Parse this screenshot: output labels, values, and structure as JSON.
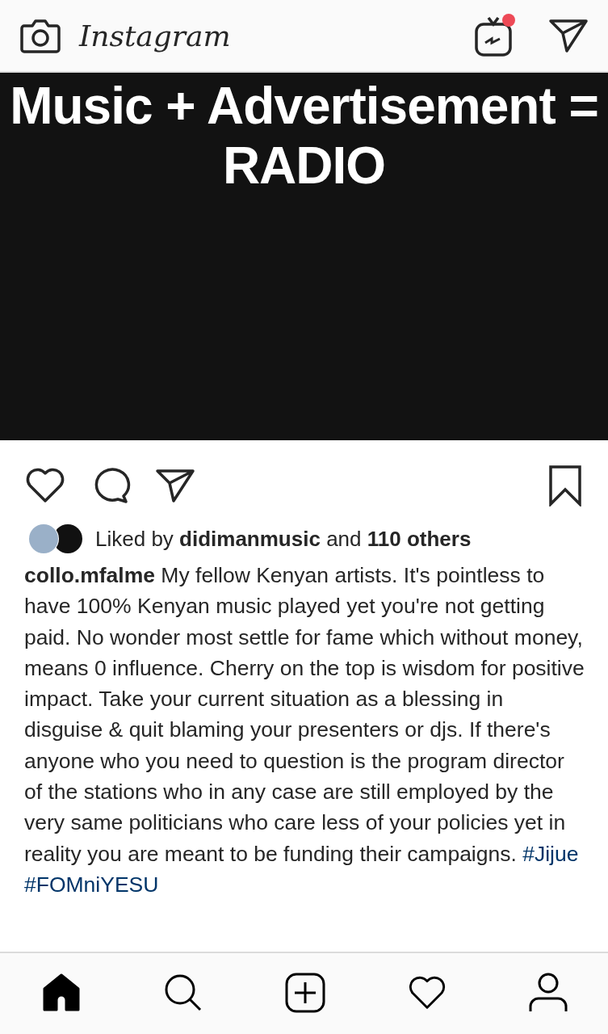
{
  "header": {
    "logo": "Instagram",
    "tv_notification": true
  },
  "post": {
    "image_lines": [
      "Music + Advertisement =",
      "RADIO"
    ],
    "saved": false,
    "liked": false,
    "likes": {
      "prefix": "Liked by ",
      "user": "didimanmusic",
      "middle": " and ",
      "count": "110 others"
    },
    "caption": {
      "user": "collo.mfalme",
      "text": " My fellow Kenyan artists. It's pointless to have 100% Kenyan music played yet you're not getting paid. No wonder most settle for fame which without money,  means 0 influence. Cherry on the top is wisdom for positive impact. Take your current situation as a blessing in disguise & quit blaming your presenters or djs. If there's anyone who you need to question is the program director of the stations who in any case are still employed by the very same politicians who care less of your policies yet in reality you are meant to be funding their campaigns. ",
      "hashtags": [
        "#Jijue",
        "#FOMniYESU"
      ]
    }
  },
  "nav": [
    {
      "kind": "home",
      "selected": true
    },
    {
      "kind": "search",
      "selected": false
    },
    {
      "kind": "add",
      "selected": false
    },
    {
      "kind": "activity",
      "selected": false
    },
    {
      "kind": "profile",
      "selected": false
    }
  ]
}
